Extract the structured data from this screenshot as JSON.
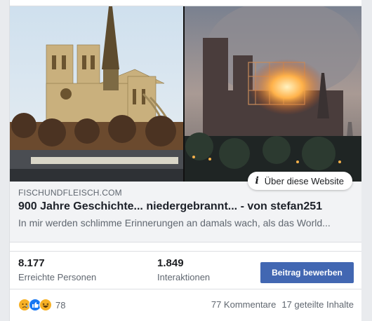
{
  "preview": {
    "about_label": "Über diese Website",
    "domain": "FISCHUNDFLEISCH.COM",
    "title": "900 Jahre Geschichte... niedergebrannt... - von stefan251",
    "description": "In mir werden schlimme Erinnerungen an damals wach, als das World..."
  },
  "stats": {
    "reach_value": "8.177",
    "reach_label": "Erreichte Personen",
    "interactions_value": "1.849",
    "interactions_label": "Interaktionen",
    "promote_label": "Beitrag bewerben"
  },
  "reactions": {
    "icons": [
      "sad-reaction-icon",
      "like-reaction-icon",
      "haha-reaction-icon"
    ],
    "count": "78",
    "comments": "77 Kommentare",
    "shares": "17 geteilte Inhalte"
  },
  "colors": {
    "primary_button": "#4267b2",
    "like": "#1877f2",
    "reaction_yellow": "#f7b125"
  }
}
